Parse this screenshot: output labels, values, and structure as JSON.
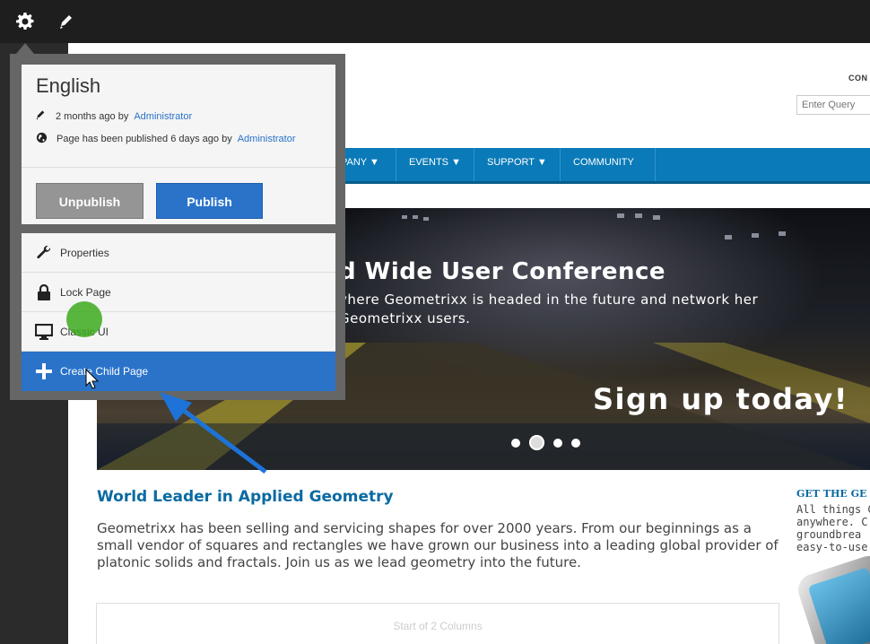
{
  "toolbar": {
    "settings_icon": "gear-icon",
    "edit_icon": "pencil-icon"
  },
  "page": {
    "search_label": "CON",
    "search_placeholder": "Enter Query",
    "nav_items": [
      "PANY ▼",
      "EVENTS ▼",
      "SUPPORT ▼",
      "COMMUNITY"
    ],
    "hero": {
      "title": "d Wide User Conference",
      "subtitle": "vhere Geometrixx is headed in the future and network her Geometrixx users.",
      "cta": "Sign up today!"
    },
    "heading": "World Leader in Applied Geometry",
    "paragraph": "Geometrixx has been selling and servicing shapes for over 2000 years. From our beginnings as a small vendor of squares and rectangles we have grown our business into a leading global provider of platonic solids and fractals. Join us as we lead geometry into the future.",
    "side_heading": "GET THE GE",
    "side_text": "All things G\nanywhere. C\ngroundbrea\neasy-to-use",
    "columns_label": "Start of 2 Columns",
    "carousel_active_index": 1,
    "carousel_count": 4
  },
  "popover": {
    "title": "English",
    "meta1_text": "2 months ago by",
    "meta1_link": "Administrator",
    "meta2_text": "Page has been published 6 days ago by",
    "meta2_link": "Administrator",
    "unpublish": "Unpublish",
    "publish": "Publish",
    "actions": [
      {
        "label": "Properties",
        "icon": "wrench-icon"
      },
      {
        "label": "Lock Page",
        "icon": "lock-icon"
      },
      {
        "label": "Classic UI",
        "icon": "monitor-icon"
      },
      {
        "label": "Create Child Page",
        "icon": "plus-icon"
      }
    ]
  },
  "colors": {
    "accent": "#2a73c9",
    "nav": "#0a7ab8",
    "topbar": "#1e1e1e",
    "heading": "#0a6aa1"
  }
}
